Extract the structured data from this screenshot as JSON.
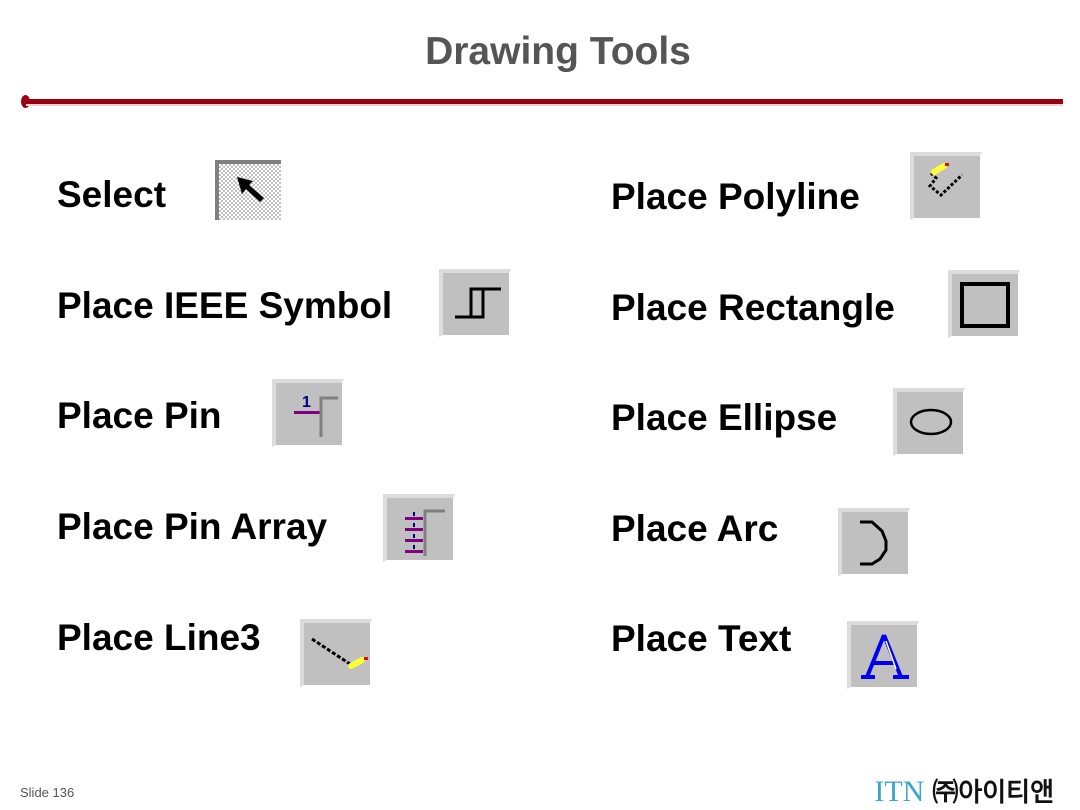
{
  "slide": {
    "title": "Drawing Tools",
    "accent_color": "#990011",
    "slide_number_label": "Slide 136",
    "brand_name": "ITN",
    "brand_korean": "㈜아이티앤"
  },
  "tools": [
    {
      "label": "Select",
      "icon": "select-arrow-icon",
      "state": "pressed"
    },
    {
      "label": "Place Polyline",
      "icon": "polyline-icon",
      "state": "normal"
    },
    {
      "label": "Place IEEE Symbol",
      "icon": "ieee-symbol-icon",
      "state": "normal"
    },
    {
      "label": "Place Rectangle",
      "icon": "rectangle-icon",
      "state": "normal"
    },
    {
      "label": "Place Pin",
      "icon": "pin-icon",
      "state": "normal",
      "icon_text": "1"
    },
    {
      "label": "Place Ellipse",
      "icon": "ellipse-icon",
      "state": "normal"
    },
    {
      "label": "Place Pin Array",
      "icon": "pin-array-icon",
      "state": "normal"
    },
    {
      "label": "Place Arc",
      "icon": "arc-icon",
      "state": "normal"
    },
    {
      "label": "Place Line3",
      "icon": "line-icon",
      "state": "normal"
    },
    {
      "label": "Place Text",
      "icon": "text-icon",
      "state": "normal",
      "icon_text": "A"
    }
  ]
}
